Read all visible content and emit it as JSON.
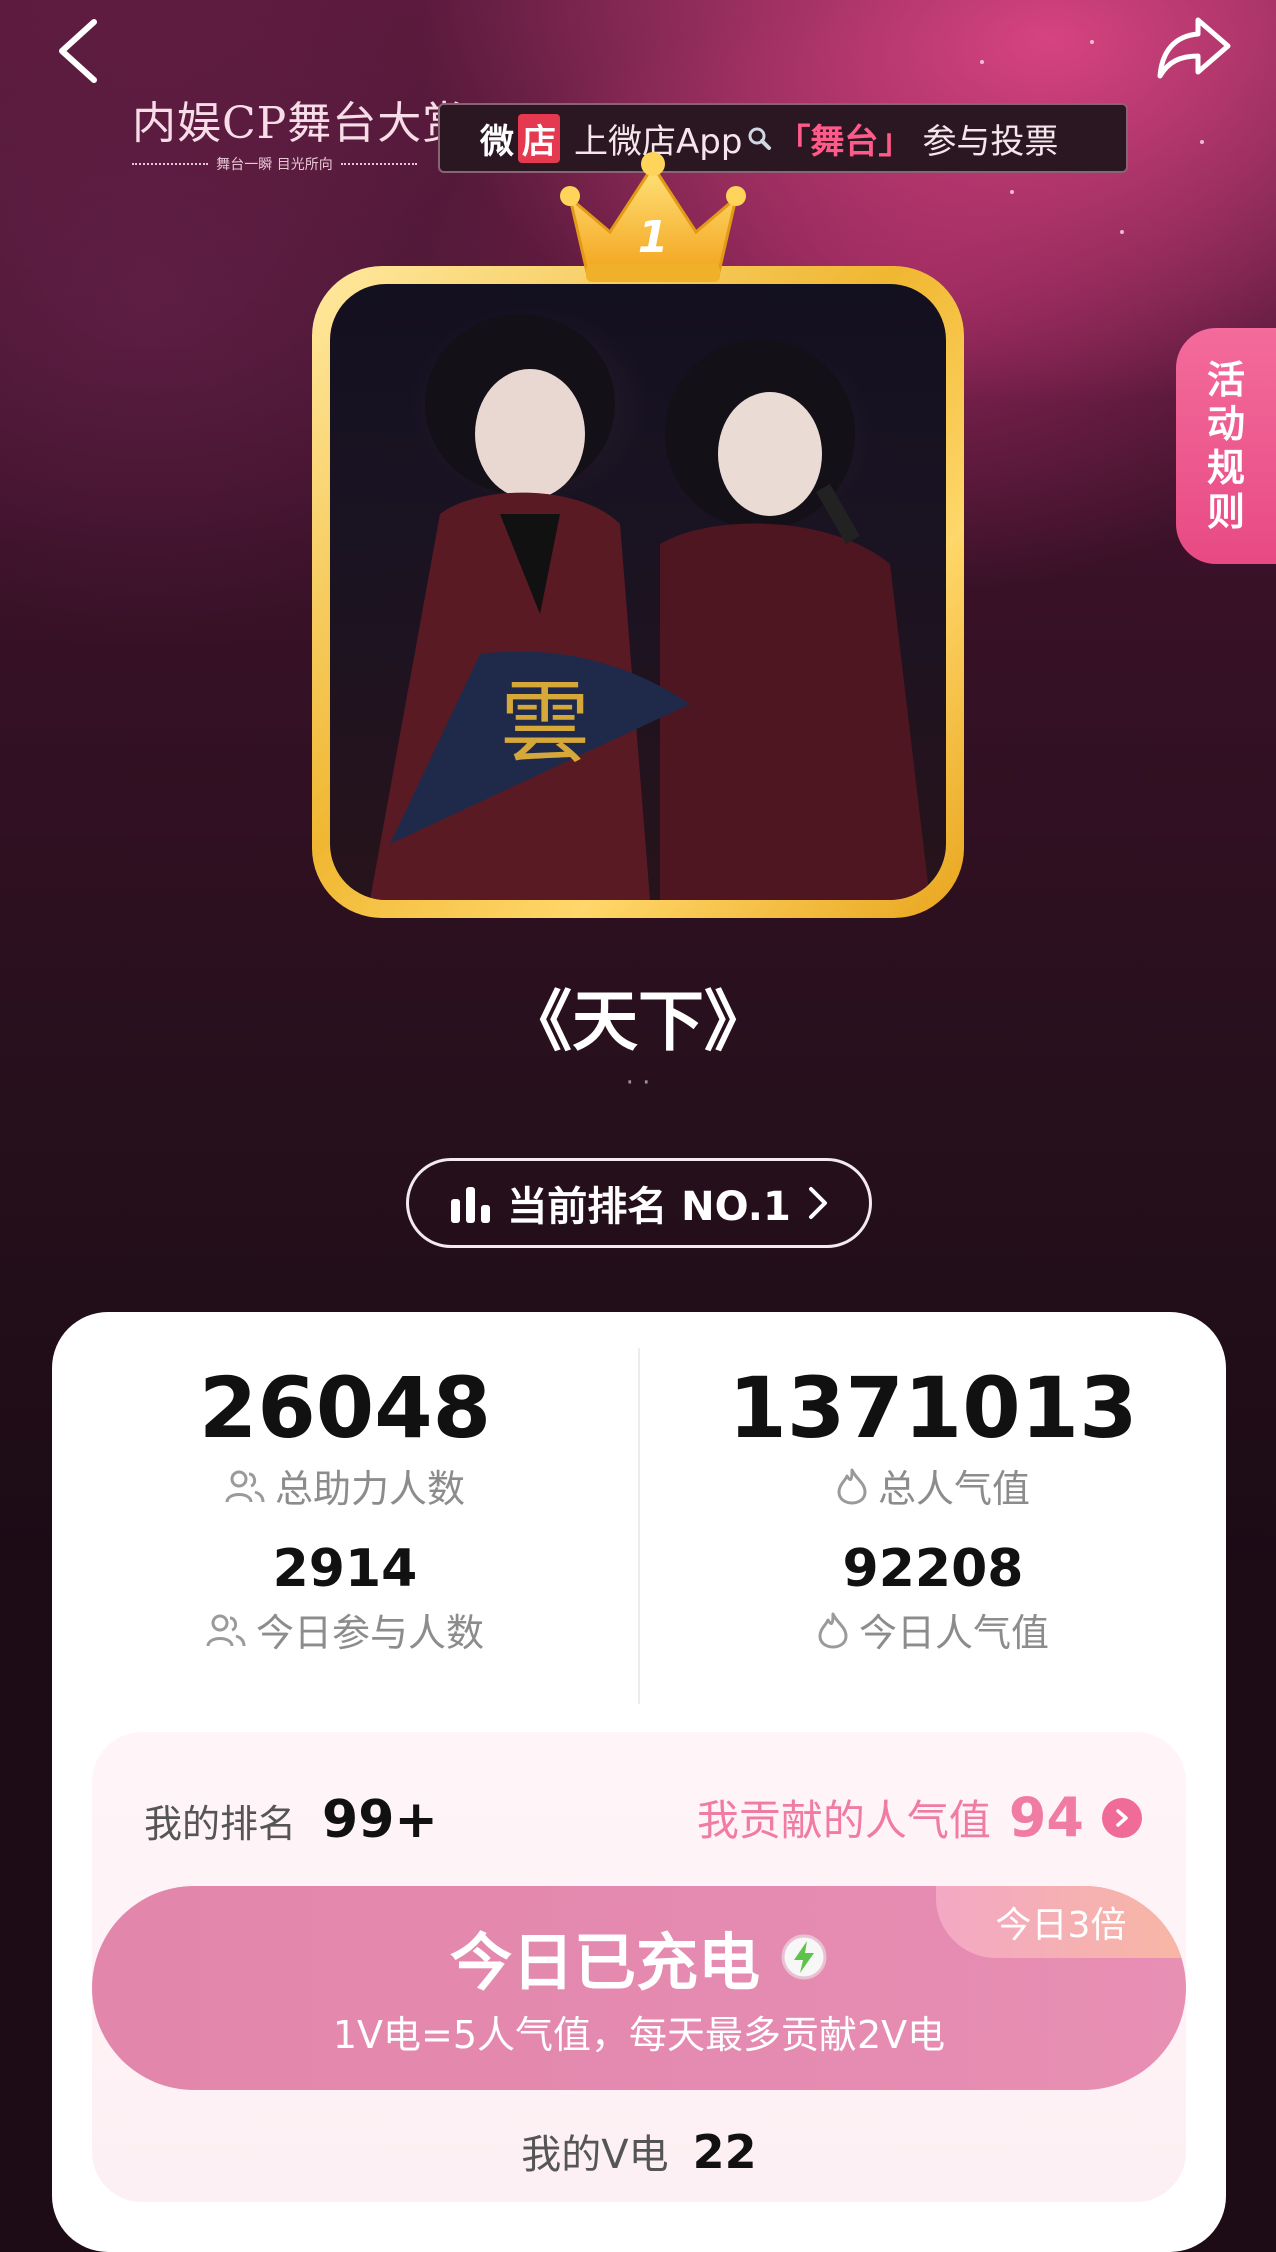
{
  "header": {
    "logo_text": "内娱CP舞台大赏",
    "logo_sub": "舞台一瞬 目光所向",
    "banner": {
      "wei": "微",
      "dian": "店",
      "text_a": "上微店App",
      "text_b": "「舞台」",
      "text_c": "参与投票"
    }
  },
  "rank_badge": "1",
  "side_tab": {
    "chars": [
      "活",
      "动",
      "规",
      "则"
    ]
  },
  "stage": {
    "title": "《天下》",
    "subtitle": "· ·"
  },
  "rank_pill": {
    "label": "当前排名 NO.1"
  },
  "stats": {
    "total_helpers": {
      "value": "26048",
      "label": "总助力人数"
    },
    "total_popularity": {
      "value": "1371013",
      "label": "总人气值"
    },
    "today_participants": {
      "value": "2914",
      "label": "今日参与人数"
    },
    "today_popularity": {
      "value": "92208",
      "label": "今日人气值"
    }
  },
  "my": {
    "rank_label": "我的排名",
    "rank_value": "99+",
    "contrib_label": "我贡献的人气值",
    "contrib_value": "94",
    "charge_title": "今日已充电",
    "charge_sub": "1V电=5人气值，每天最多贡献2V电",
    "bonus": "今日3倍",
    "v_label": "我的V电",
    "v_value": "22"
  },
  "colors": {
    "accent_pink": "#f07ba3",
    "button_pink": "#e58ab0",
    "gold": "#f0b731",
    "bg_dark": "#26101c"
  },
  "icons": [
    "back-icon",
    "share-icon",
    "search-icon",
    "crown-icon",
    "bar-chart-icon",
    "chevron-right-icon",
    "user-group-icon",
    "flame-icon",
    "lightning-icon"
  ]
}
